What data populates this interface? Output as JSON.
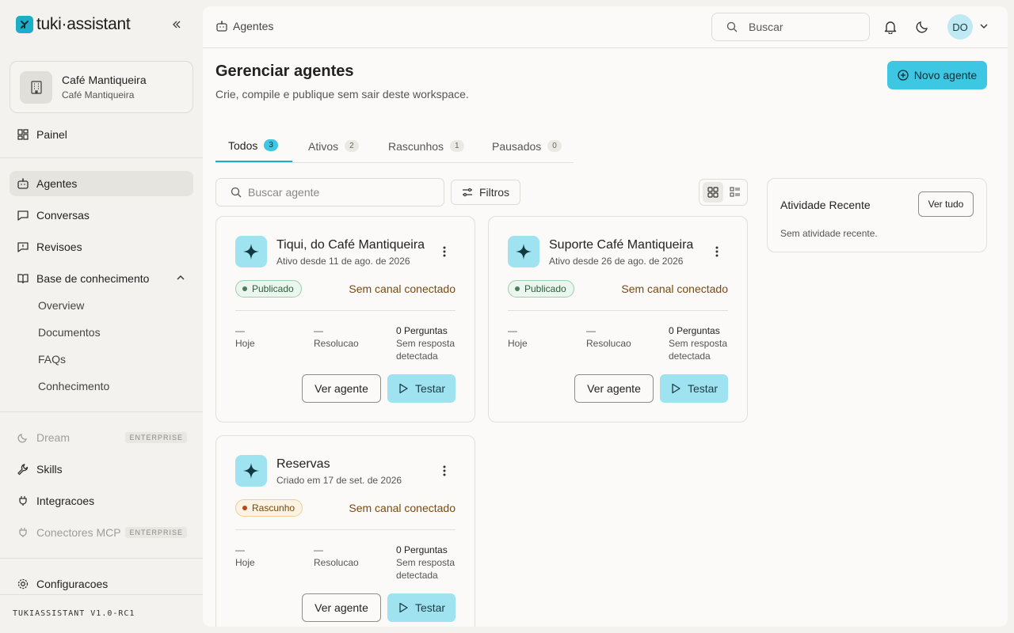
{
  "app": {
    "logo_prefix": "tuki",
    "logo_suffix": "assistant",
    "version": "TUKIASSISTANT V1.0-RC1"
  },
  "workspace": {
    "name": "Café Mantiqueira",
    "subtitle": "Café Mantiqueira"
  },
  "sidebar": {
    "painel": "Painel",
    "agentes": "Agentes",
    "conversas": "Conversas",
    "revisoes": "Revisoes",
    "base": "Base de conhecimento",
    "base_items": [
      "Overview",
      "Documentos",
      "FAQs",
      "Conhecimento"
    ],
    "dream": "Dream",
    "enterprise_badge": "ENTERPRISE",
    "skills": "Skills",
    "integracoes": "Integracoes",
    "conectores": "Conectores MCP",
    "configuracoes": "Configuracoes"
  },
  "topbar": {
    "breadcrumb": "Agentes",
    "search_placeholder": "Buscar",
    "avatar_initials": "DO"
  },
  "page": {
    "title": "Gerenciar agentes",
    "subtitle": "Crie, compile e publique sem sair deste workspace.",
    "new_button": "Novo agente"
  },
  "tabs": [
    {
      "label": "Todos",
      "count": "3"
    },
    {
      "label": "Ativos",
      "count": "2"
    },
    {
      "label": "Rascunhos",
      "count": "1"
    },
    {
      "label": "Pausados",
      "count": "0"
    }
  ],
  "toolbar": {
    "search_placeholder": "Buscar agente",
    "filters_label": "Filtros"
  },
  "agents": [
    {
      "name": "Tiqui, do Café Mantiqueira",
      "since": "Ativo desde 11 de ago. de 2026",
      "status": "Publicado",
      "channel": "Sem canal conectado",
      "stat1_value": "—",
      "stat1_label": "Hoje",
      "stat2_value": "—",
      "stat2_label": "Resolucao",
      "stat3_value": "0 Perguntas",
      "stat3_line1": "Sem resposta",
      "stat3_line2": "detectada",
      "view_label": "Ver agente",
      "test_label": "Testar"
    },
    {
      "name": "Suporte Café Mantiqueira",
      "since": "Ativo desde 26 de ago. de 2026",
      "status": "Publicado",
      "channel": "Sem canal conectado",
      "stat1_value": "—",
      "stat1_label": "Hoje",
      "stat2_value": "—",
      "stat2_label": "Resolucao",
      "stat3_value": "0 Perguntas",
      "stat3_line1": "Sem resposta",
      "stat3_line2": "detectada",
      "view_label": "Ver agente",
      "test_label": "Testar"
    },
    {
      "name": "Reservas",
      "since": "Criado em 17 de set. de 2026",
      "status": "Rascunho",
      "channel": "Sem canal conectado",
      "stat1_value": "—",
      "stat1_label": "Hoje",
      "stat2_value": "—",
      "stat2_label": "Resolucao",
      "stat3_value": "0 Perguntas",
      "stat3_line1": "Sem resposta",
      "stat3_line2": "detectada",
      "view_label": "Ver agente",
      "test_label": "Testar"
    }
  ],
  "activity": {
    "title": "Atividade Recente",
    "button": "Ver tudo",
    "empty": "Sem atividade recente."
  },
  "colors": {
    "accent": "#3ec7e2",
    "accent_light": "#9fe3f1",
    "published": "#4b7a55",
    "draft": "#b4481f"
  }
}
